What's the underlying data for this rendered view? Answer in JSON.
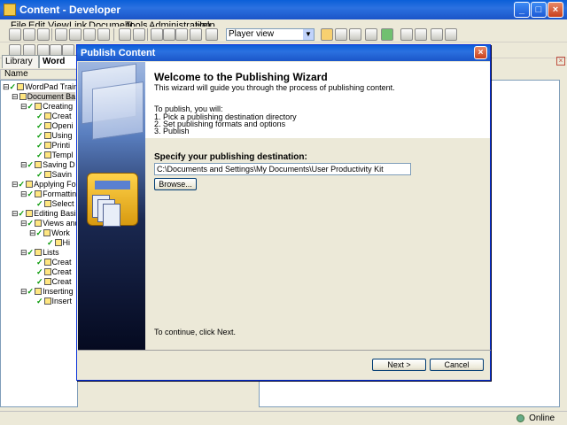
{
  "window": {
    "title": "Content - Developer"
  },
  "menu": [
    "File",
    "Edit",
    "View",
    "Link",
    "Document",
    "Tools",
    "Administration",
    "Help"
  ],
  "toolbar": {
    "player_view": "Player view"
  },
  "left_pane": {
    "tabs": [
      "Library",
      "Word"
    ],
    "column_header": "Name",
    "tree": [
      "WordPad Training",
      "Document Ba",
      "Creating",
      "Creat",
      "Openi",
      "Using",
      "Printi",
      "Templ",
      "Saving D",
      "Savin",
      "Applying Form",
      "Formattin",
      "Select",
      "Editing Basics",
      "Views and",
      "Work",
      "Hi",
      "Lists",
      "Creat",
      "Creat",
      "Creat",
      "Inserting",
      "Insert"
    ]
  },
  "dialog": {
    "title": "Publish Content",
    "close": "×",
    "heading": "Welcome to the Publishing Wizard",
    "subheading": "This wizard will guide you through the process of publishing content.",
    "intro": "To publish, you will:",
    "steps": [
      "1. Pick a publishing destination directory",
      "2. Set publishing formats and options",
      "3. Publish"
    ],
    "dest_label": "Specify your publishing destination:",
    "dest_value": "C:\\Documents and Settings\\My Documents\\User Productivity Kit",
    "browse": "Browse...",
    "continue_text": "To continue, click Next.",
    "next": "Next >",
    "cancel": "Cancel"
  },
  "status": {
    "online": "Online"
  }
}
